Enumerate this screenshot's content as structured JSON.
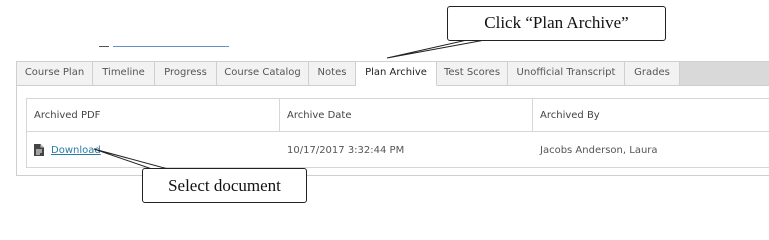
{
  "tabs": [
    {
      "label": "Course Plan",
      "active": false
    },
    {
      "label": "Timeline",
      "active": false
    },
    {
      "label": "Progress",
      "active": false
    },
    {
      "label": "Course Catalog",
      "active": false
    },
    {
      "label": "Notes",
      "active": false
    },
    {
      "label": "Plan Archive",
      "active": true
    },
    {
      "label": "Test Scores",
      "active": false
    },
    {
      "label": "Unofficial Transcript",
      "active": false
    },
    {
      "label": "Grades",
      "active": false
    }
  ],
  "table": {
    "headers": [
      "Archived PDF",
      "Archive Date",
      "Archived By"
    ],
    "rows": [
      {
        "icon": "document-icon",
        "link": "Download",
        "date": "10/17/2017 3:32:44 PM",
        "by": "Jacobs Anderson, Laura"
      }
    ]
  },
  "callouts": {
    "archive": "Click “Plan Archive”",
    "select": "Select document"
  },
  "colors": {
    "link": "#2a7aa6",
    "tab_bar": "#d9d9d9",
    "tab": "#f2f2f2"
  }
}
